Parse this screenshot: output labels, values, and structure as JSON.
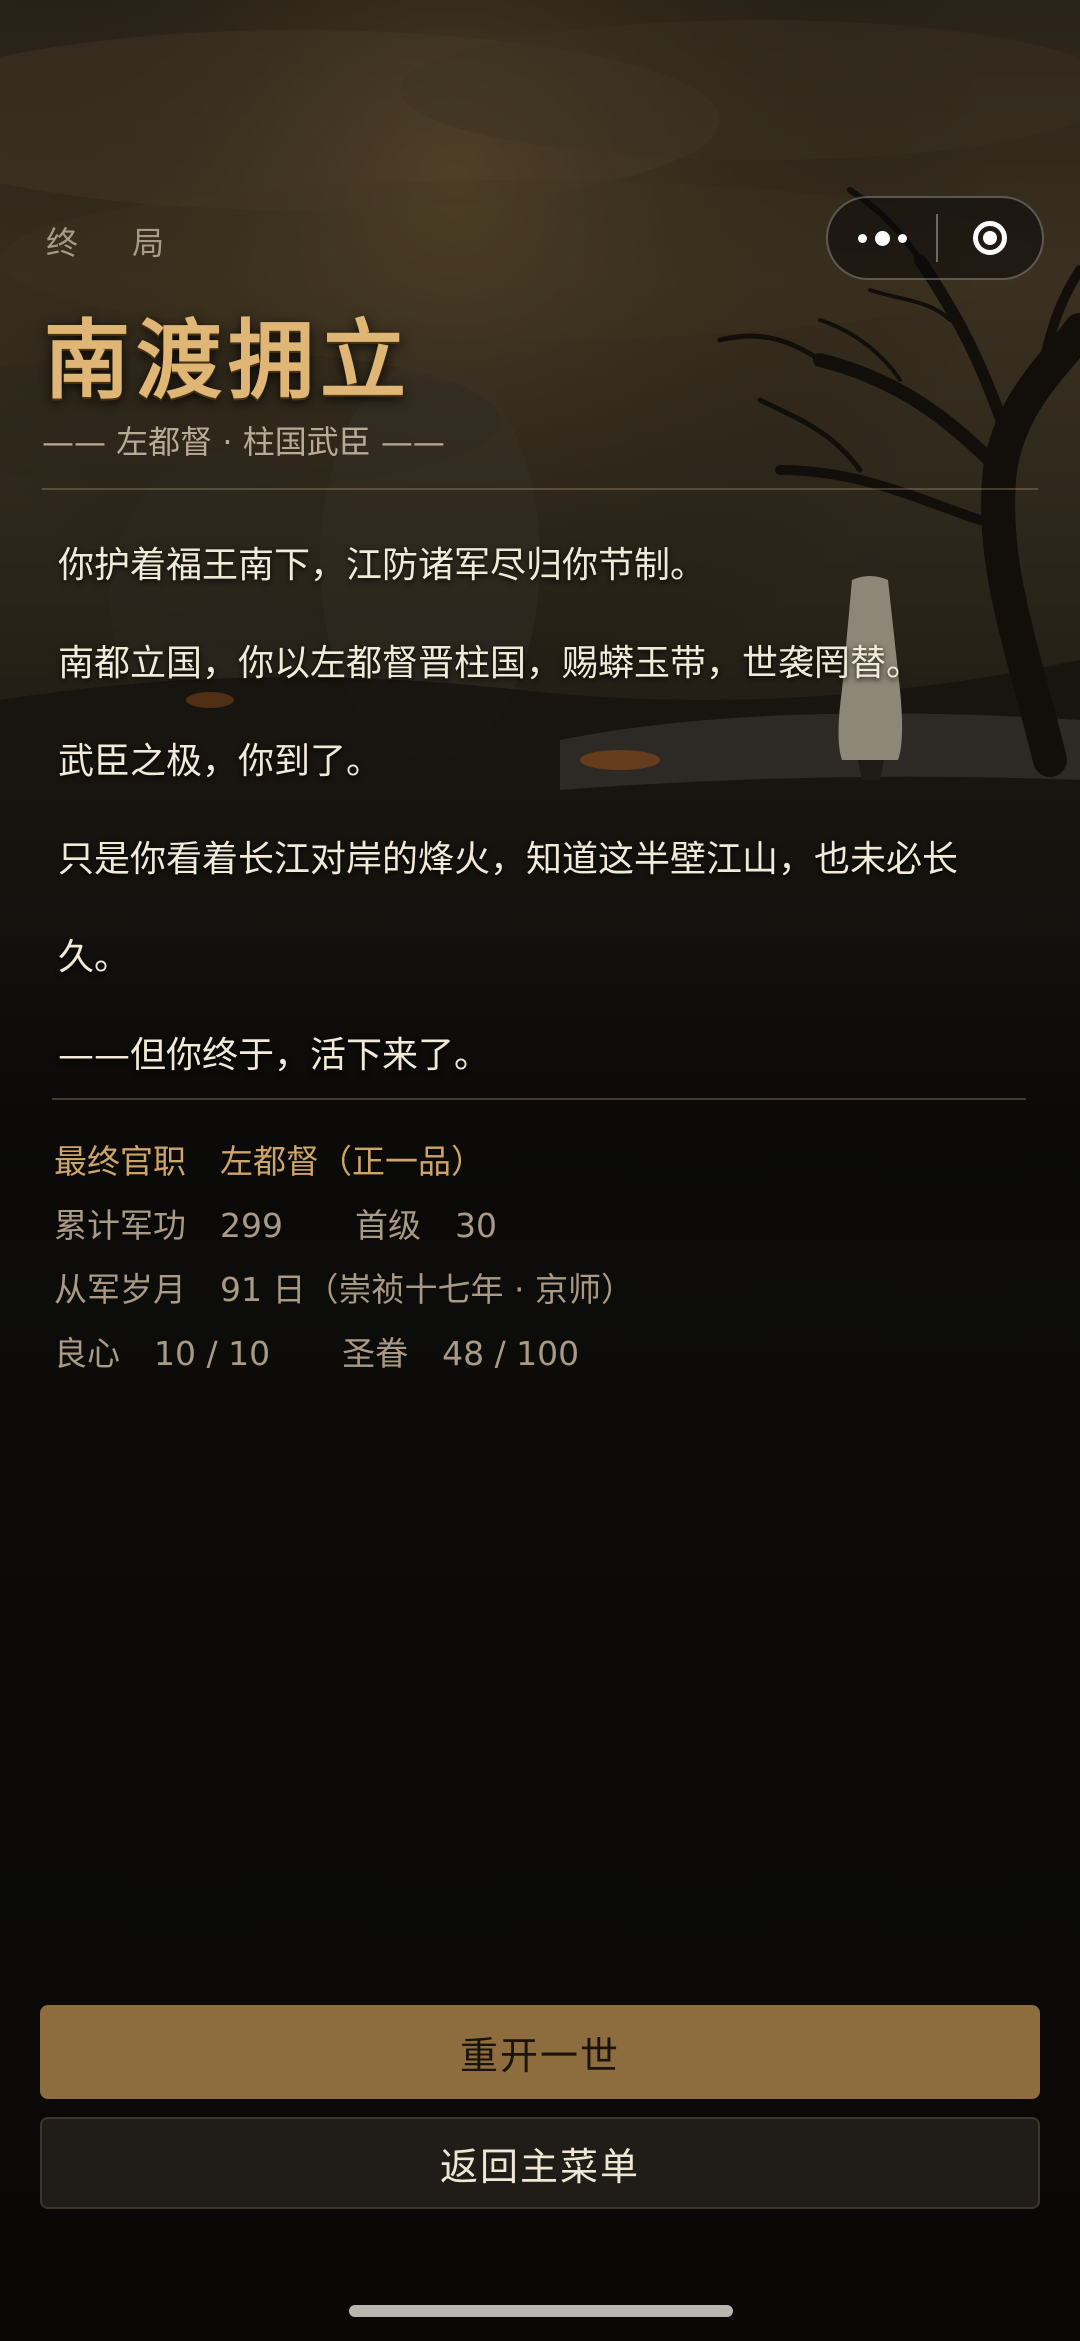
{
  "header": {
    "kicker": "终 局",
    "title": "南渡拥立",
    "subtitle": "—— 左都督 · 柱国武臣 ——"
  },
  "capsule": {
    "more_icon": "more-dots-icon",
    "close_icon": "target-close-icon"
  },
  "story": {
    "paragraphs": [
      "你护着福王南下，江防诸军尽归你节制。",
      "南都立国，你以左都督晋柱国，赐蟒玉带，世袭罔替。",
      "武臣之极，你到了。",
      "只是你看着长江对岸的烽火，知道这半壁江山，也未必长久。",
      "——但你终于，活下来了。"
    ]
  },
  "stats": {
    "rank_label": "最终官职",
    "rank_value": "左都督（正一品）",
    "merit_label": "累计军功",
    "merit_value": "299",
    "heads_label": "首级",
    "heads_value": "30",
    "service_label": "从军岁月",
    "service_value": "91 日（崇祯十七年 · 京师）",
    "conscience_label": "良心",
    "conscience_value": "10 / 10",
    "favor_label": "圣眷",
    "favor_value": "48 / 100"
  },
  "buttons": {
    "restart": "重开一世",
    "main_menu": "返回主菜单"
  },
  "colors": {
    "accent_gold": "#e0b676",
    "primary_button": "#8d6c3e",
    "background": "#0a0908"
  }
}
